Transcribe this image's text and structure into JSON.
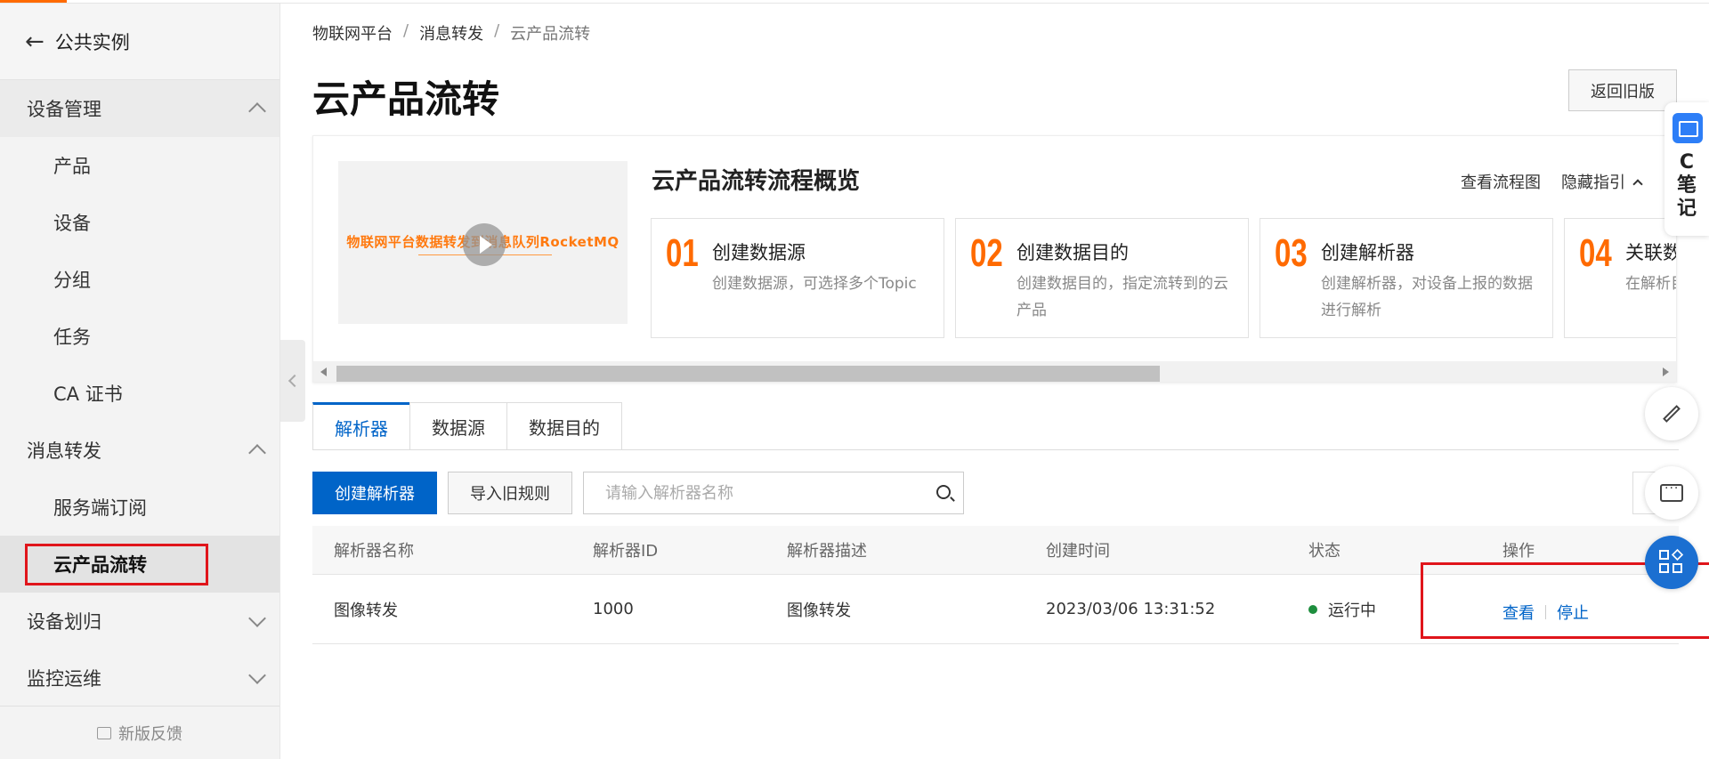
{
  "sidebar": {
    "back_label": "公共实例",
    "groups": [
      {
        "label": "设备管理",
        "items": [
          "产品",
          "设备",
          "分组",
          "任务",
          "CA 证书"
        ]
      },
      {
        "label": "消息转发",
        "items": [
          "服务端订阅",
          "云产品流转"
        ]
      },
      {
        "label": "设备划归",
        "items": []
      },
      {
        "label": "监控运维",
        "items": []
      }
    ],
    "feedback_label": "新版反馈"
  },
  "breadcrumb": [
    "物联网平台",
    "消息转发",
    "云产品流转"
  ],
  "page_title": "云产品流转",
  "old_version_button": "返回旧版",
  "guide": {
    "video_text": "物联网平台数据转发到消息队列RocketMQ",
    "title": "云产品流转流程概览",
    "link_flowchart": "查看流程图",
    "link_hide": "隐藏指引",
    "steps": [
      {
        "num": "01",
        "title": "创建数据源",
        "desc": "创建数据源，可选择多个Topic"
      },
      {
        "num": "02",
        "title": "创建数据目的",
        "desc": "创建数据目的，指定流转到的云产品"
      },
      {
        "num": "03",
        "title": "创建解析器",
        "desc": "创建解析器，对设备上报的数据进行解析"
      },
      {
        "num": "04",
        "title": "关联数",
        "desc": "在解析目的"
      }
    ]
  },
  "tabs": [
    "解析器",
    "数据源",
    "数据目的"
  ],
  "toolbar": {
    "create_button": "创建解析器",
    "import_button": "导入旧规则",
    "search_placeholder": "请输入解析器名称"
  },
  "table": {
    "headers": [
      "解析器名称",
      "解析器ID",
      "解析器描述",
      "创建时间",
      "状态",
      "操作"
    ],
    "rows": [
      {
        "name": "图像转发",
        "id": "1000",
        "desc": "图像转发",
        "created": "2023/03/06 13:31:52",
        "status": "运行中",
        "action_view": "查看",
        "action_stop": "停止"
      }
    ]
  },
  "float": {
    "note_text": "C\n笔\n记"
  },
  "colors": {
    "accent": "#ff6a00",
    "primary": "#0064c8",
    "highlight_box": "#e0151b",
    "status_running": "#1e8e3e"
  }
}
